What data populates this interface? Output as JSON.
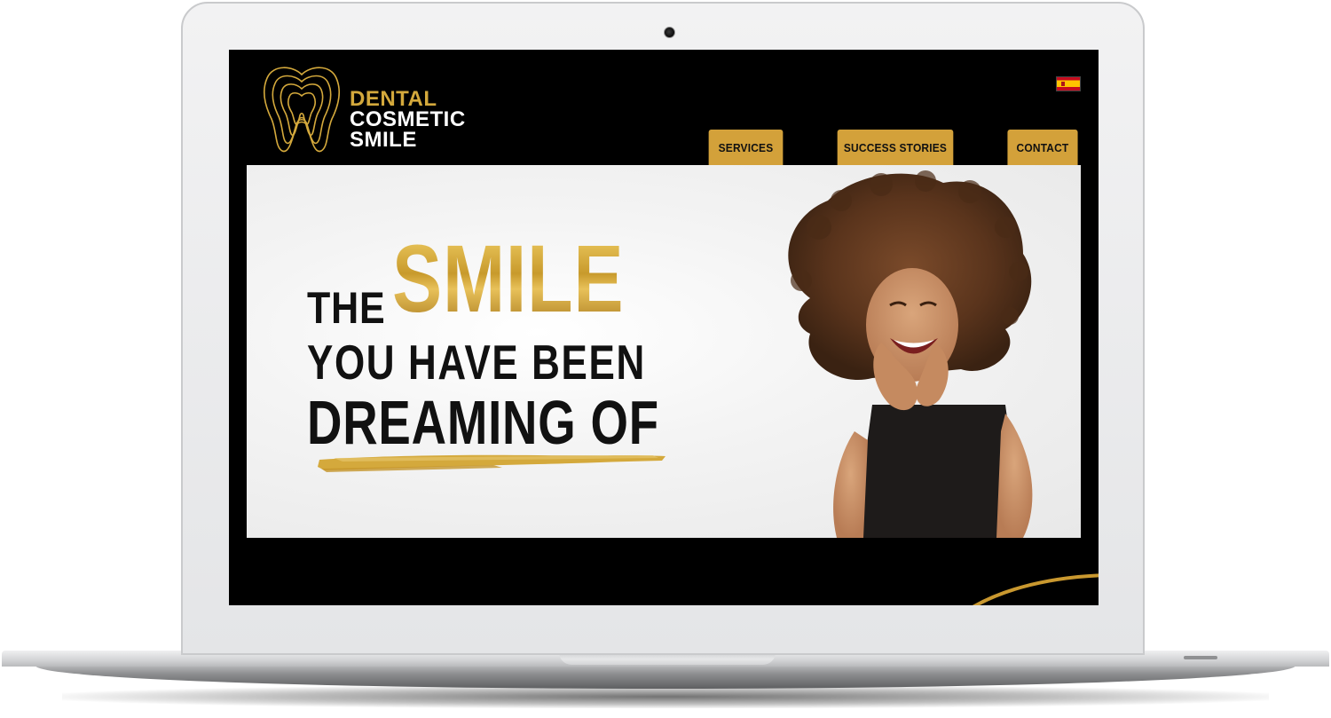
{
  "brand": {
    "line1": "DENTAL",
    "line2": "COSMETIC",
    "line3": "SMILE",
    "gold_color": "#d4a93c"
  },
  "language": {
    "flag": "spain-flag-icon"
  },
  "nav": {
    "items": [
      {
        "label": "SERVICES"
      },
      {
        "label": "SUCCESS STORIES"
      },
      {
        "label": "CONTACT"
      }
    ],
    "button_color": "#d3a13a"
  },
  "hero": {
    "word_the": "THE",
    "word_smile": "SMILE",
    "line2": "YOU HAVE BEEN",
    "line3": "DREAMING OF",
    "accent_color": "#d4a93c"
  },
  "colors": {
    "screen_bg": "#000000",
    "hero_bg": "#f2f2f2",
    "text_dark": "#111111"
  }
}
